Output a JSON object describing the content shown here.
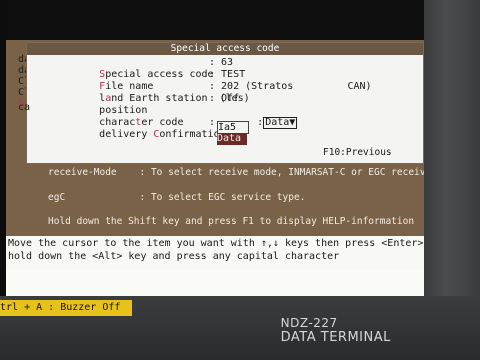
{
  "left_stub": [
    "da",
    "da",
    "Cl",
    "Cl",
    "Sp",
    "ca"
  ],
  "dialog": {
    "title": "Special access code",
    "fields": [
      {
        "first": "S",
        "rest": "pecial access code",
        "value": ": 63"
      },
      {
        "first": "F",
        "rest": "ile name",
        "value": ": TEST"
      },
      {
        "pre": "l",
        "first": "a",
        "rest": "nd Earth station  (les)",
        "value": ": 202 (Stratos         CAN)"
      },
      {
        "pre": "",
        "first": "",
        "rest": "position",
        "value": ": Off"
      },
      {
        "pre": "charac",
        "first": "t",
        "rest": "er code",
        "value": ":"
      },
      {
        "pre": "delivery ",
        "first": "C",
        "rest": "onfirmation",
        "value": ":"
      }
    ],
    "character_code_selected": "Data",
    "dropdown_arrow": "▼",
    "dropdown_options": [
      "Ia5",
      "Data"
    ],
    "footer_key": "F10:Previous"
  },
  "help": {
    "receive_mode": "receive-Mode    : To select receive mode, INMARSAT-C or EGC receive only.",
    "egc": "egC             : To select EGC service type.",
    "shift_help": "Hold down the Shift key and press F1 to display HELP-information"
  },
  "status": {
    "line1": "Move the cursor to the item you want with ↑,↓ keys then press <Enter>, or",
    "line2": "hold down the <Alt> key and press any capital character"
  },
  "bottom": {
    "buzzer": "trl + A : Buzzer Off",
    "model": "NDZ-227",
    "terminal": "DATA TERMINAL"
  },
  "colors": {
    "panel": "#7a6248",
    "dialog_title": "#6b5844",
    "highlight_letter": "#b0305a",
    "buzzer": "#e6c21a"
  }
}
